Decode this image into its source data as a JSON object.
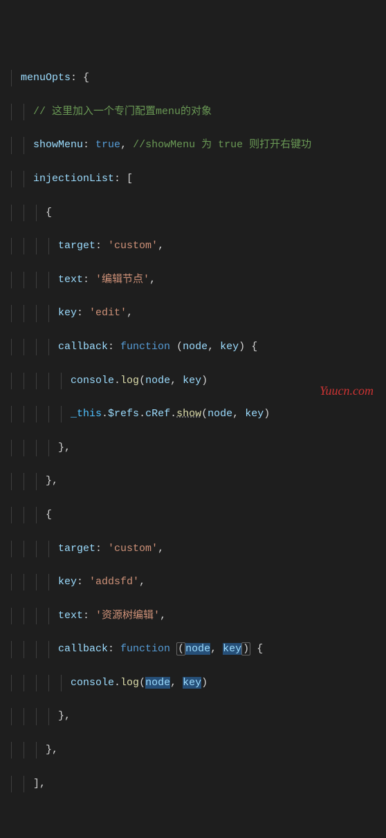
{
  "code": {
    "l1_key": "menuOpts",
    "l1_after": ": {",
    "l2_comment": "// 这里加入一个专门配置menu的对象",
    "l3_key": "showMenu",
    "l3_colon": ": ",
    "l3_val": "true",
    "l3_comma": ", ",
    "l3_comment": "//showMenu 为 true 则打开右键功",
    "l4_key": "injectionList",
    "l4_after": ": [",
    "brace_open": "{",
    "target_key": "target",
    "text_key": "text",
    "key_key": "key",
    "callback_key": "callback",
    "str_custom": "'custom'",
    "str_edit_node": "'编辑节点'",
    "str_edit": "'edit'",
    "str_addsfd": "'addsfd'",
    "str_resource_tree": "'资源树编辑'",
    "colon_sp": ": ",
    "comma": ",",
    "kw_function": "function",
    "sp": " ",
    "paren_open": "(",
    "paren_close": ")",
    "param_node": "node",
    "param_key": "key",
    "brace_close": "}",
    "console": "console",
    "dot": ".",
    "log": "log",
    "this": "_this",
    "refs": "$refs",
    "cref": "cRef",
    "show": "show",
    "bracket_close": "],",
    "brace_close_comma": "},"
  },
  "watermark": "Yuucn.com"
}
